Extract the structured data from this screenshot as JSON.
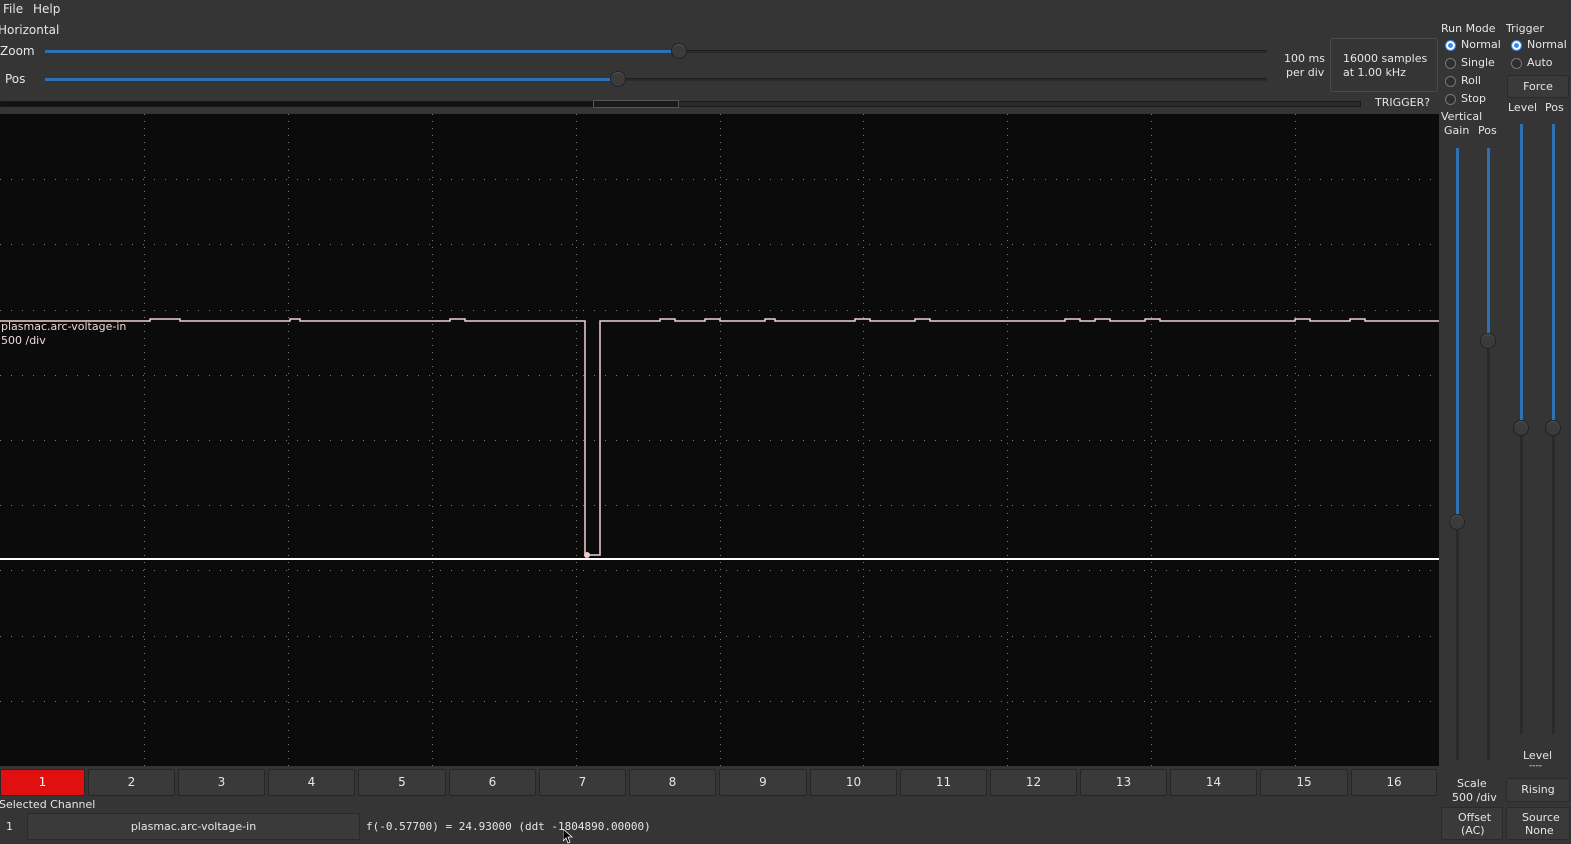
{
  "menu": {
    "file": "File",
    "help": "Help"
  },
  "horizontal": {
    "title": "Horizontal",
    "zoom_label": "Zoom",
    "pos_label": "Pos",
    "zoom_value": 0.52,
    "pos_value": 0.47,
    "time_per_div_line1": "100 ms",
    "time_per_div_line2": "per div",
    "samples_line1": "16000 samples",
    "samples_line2": "at 1.00 kHz",
    "trigger_status": "TRIGGER?"
  },
  "run_mode": {
    "title": "Run Mode",
    "options": [
      "Normal",
      "Single",
      "Roll",
      "Stop"
    ],
    "selected": "Normal"
  },
  "trigger": {
    "title": "Trigger",
    "options": [
      "Normal",
      "Auto"
    ],
    "selected": "Normal",
    "force_label": "Force",
    "level_label": "Level",
    "pos_label": "Pos",
    "level_readout_label": "Level",
    "level_readout_value": "----",
    "edge_label": "Rising",
    "source_label": "Source",
    "source_value": "None"
  },
  "vertical": {
    "title": "Vertical",
    "gain_label": "Gain",
    "pos_label": "Pos",
    "scale_label": "Scale",
    "scale_value": "500 /div",
    "offset_label": "Offset",
    "offset_value": "(AC)"
  },
  "scope": {
    "channel_name": "plasmac.arc-voltage-in",
    "channel_scale": "500 /div",
    "trace_color": "#f2d2d2",
    "grid_color": "#7a7a7a",
    "background": "#0b0b0b"
  },
  "channels": {
    "buttons": [
      "1",
      "2",
      "3",
      "4",
      "5",
      "6",
      "7",
      "8",
      "9",
      "10",
      "11",
      "12",
      "13",
      "14",
      "15",
      "16"
    ],
    "selected": "1"
  },
  "selected_channel": {
    "title": "Selected Channel",
    "number": "1",
    "name": "plasmac.arc-voltage-in",
    "readout": "f(-0.57700) =  24.93000 (ddt -1804890.00000)"
  }
}
